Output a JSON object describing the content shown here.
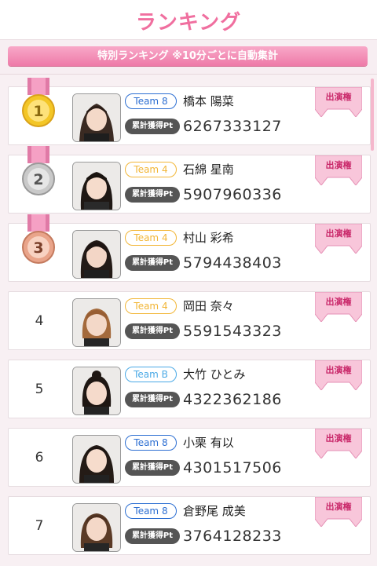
{
  "header": {
    "title": "ランキング"
  },
  "banner": {
    "text": "特別ランキング ※10分ごとに自動集計"
  },
  "labels": {
    "pt_badge": "累計獲得Pt",
    "tag": "出演権"
  },
  "colors": {
    "accent": "#f06f9f",
    "team8": "#2d6fd2",
    "team4": "#f2b637",
    "teamB": "#4aa9e6"
  },
  "rankings": [
    {
      "rank": "1",
      "medal": "gold",
      "team": "Team 8",
      "name": "橋本 陽菜",
      "points": "6267333127"
    },
    {
      "rank": "2",
      "medal": "silver",
      "team": "Team 4",
      "name": "石綿 星南",
      "points": "5907960336"
    },
    {
      "rank": "3",
      "medal": "bronze",
      "team": "Team 4",
      "name": "村山 彩希",
      "points": "5794438403"
    },
    {
      "rank": "4",
      "medal": "",
      "team": "Team 4",
      "name": "岡田 奈々",
      "points": "5591543323"
    },
    {
      "rank": "5",
      "medal": "",
      "team": "Team B",
      "name": "大竹 ひとみ",
      "points": "4322362186"
    },
    {
      "rank": "6",
      "medal": "",
      "team": "Team 8",
      "name": "小栗 有以",
      "points": "4301517506"
    },
    {
      "rank": "7",
      "medal": "",
      "team": "Team 8",
      "name": "倉野尾 成美",
      "points": "3764128233"
    }
  ]
}
